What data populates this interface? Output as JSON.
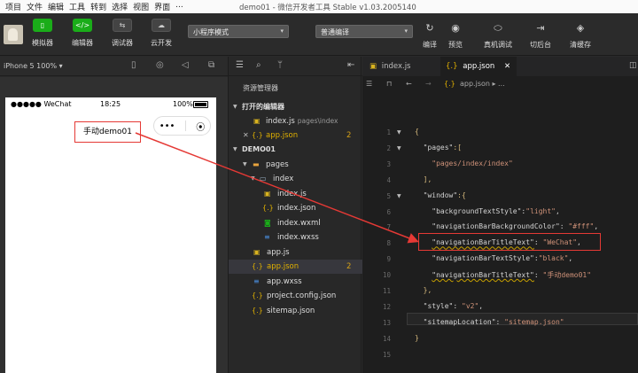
{
  "menubar": {
    "items": [
      "项目",
      "文件",
      "编辑",
      "工具",
      "转到",
      "选择",
      "视图",
      "界面",
      "..."
    ],
    "window_title": "demo01 - 微信开发者工具 Stable v1.03.2005140"
  },
  "toolbar": {
    "buttons": [
      {
        "label": "模拟器",
        "icon": "phone-icon"
      },
      {
        "label": "编辑器",
        "icon": "code-icon"
      },
      {
        "label": "调试器",
        "icon": "debug-icon"
      },
      {
        "label": "云开发",
        "icon": "cloud-icon"
      }
    ],
    "mode_select": "小程序模式",
    "compile_select": "普通编译",
    "right_buttons": [
      {
        "label": "编译",
        "icon": "refresh-icon"
      },
      {
        "label": "预览",
        "icon": "eye-icon"
      },
      {
        "label": "真机调试",
        "icon": "debug-device-icon"
      },
      {
        "label": "切后台",
        "icon": "background-icon"
      },
      {
        "label": "清缓存",
        "icon": "layers-icon"
      }
    ]
  },
  "simulator": {
    "device": "iPhone 5 100% ▾",
    "status": {
      "signal": "●●●●● WeChat",
      "time": "18:25",
      "battery": "100%"
    },
    "nav_title": "手动demo01",
    "capsule_more": "•••",
    "capsule_close": "⦿"
  },
  "explorer": {
    "title": "资源管理器",
    "open_editors_label": "打开的编辑器",
    "open_editors": [
      {
        "name": "index.js",
        "path": "pages\\index",
        "type": "js"
      },
      {
        "name": "app.json",
        "badge": "2",
        "type": "json"
      }
    ],
    "project_label": "DEMO01",
    "tree": [
      {
        "name": "pages",
        "type": "folder"
      },
      {
        "name": "index",
        "type": "folder"
      },
      {
        "name": "index.js",
        "type": "js"
      },
      {
        "name": "index.json",
        "type": "json"
      },
      {
        "name": "index.wxml",
        "type": "wxml"
      },
      {
        "name": "index.wxss",
        "type": "wxss"
      },
      {
        "name": "app.js",
        "type": "js"
      },
      {
        "name": "app.json",
        "type": "json",
        "badge": "2"
      },
      {
        "name": "app.wxss",
        "type": "wxss"
      },
      {
        "name": "project.config.json",
        "type": "json"
      },
      {
        "name": "sitemap.json",
        "type": "json"
      }
    ]
  },
  "editor": {
    "tabs": [
      {
        "label": "index.js"
      },
      {
        "label": "app.json",
        "close": "✕"
      }
    ],
    "breadcrumb": "app.json ▸ ...",
    "line_numbers": [
      "1",
      "2",
      "3",
      "4",
      "5",
      "6",
      "7",
      "8",
      "9",
      "10",
      "11",
      "12",
      "13",
      "14",
      "15"
    ],
    "lines": [
      "{",
      "  \"pages\":[",
      "    \"pages/index/index\"",
      "  ],",
      "  \"window\":{",
      "    \"backgroundTextStyle\":\"light\",",
      "    \"navigationBarBackgroundColor\": \"#fff\",",
      "    \"navigationBarTitleText\": \"WeChat\",",
      "    \"navigationBarTextStyle\":\"black\",",
      "    \"navigationBarTitleText\": \"手动demo01\"",
      "  },",
      "  \"style\": \"v2\",",
      "  \"sitemapLocation\": \"sitemap.json\"",
      "}",
      ""
    ]
  },
  "colors": {
    "accent": "#1aad19",
    "annotation": "#e53935"
  }
}
